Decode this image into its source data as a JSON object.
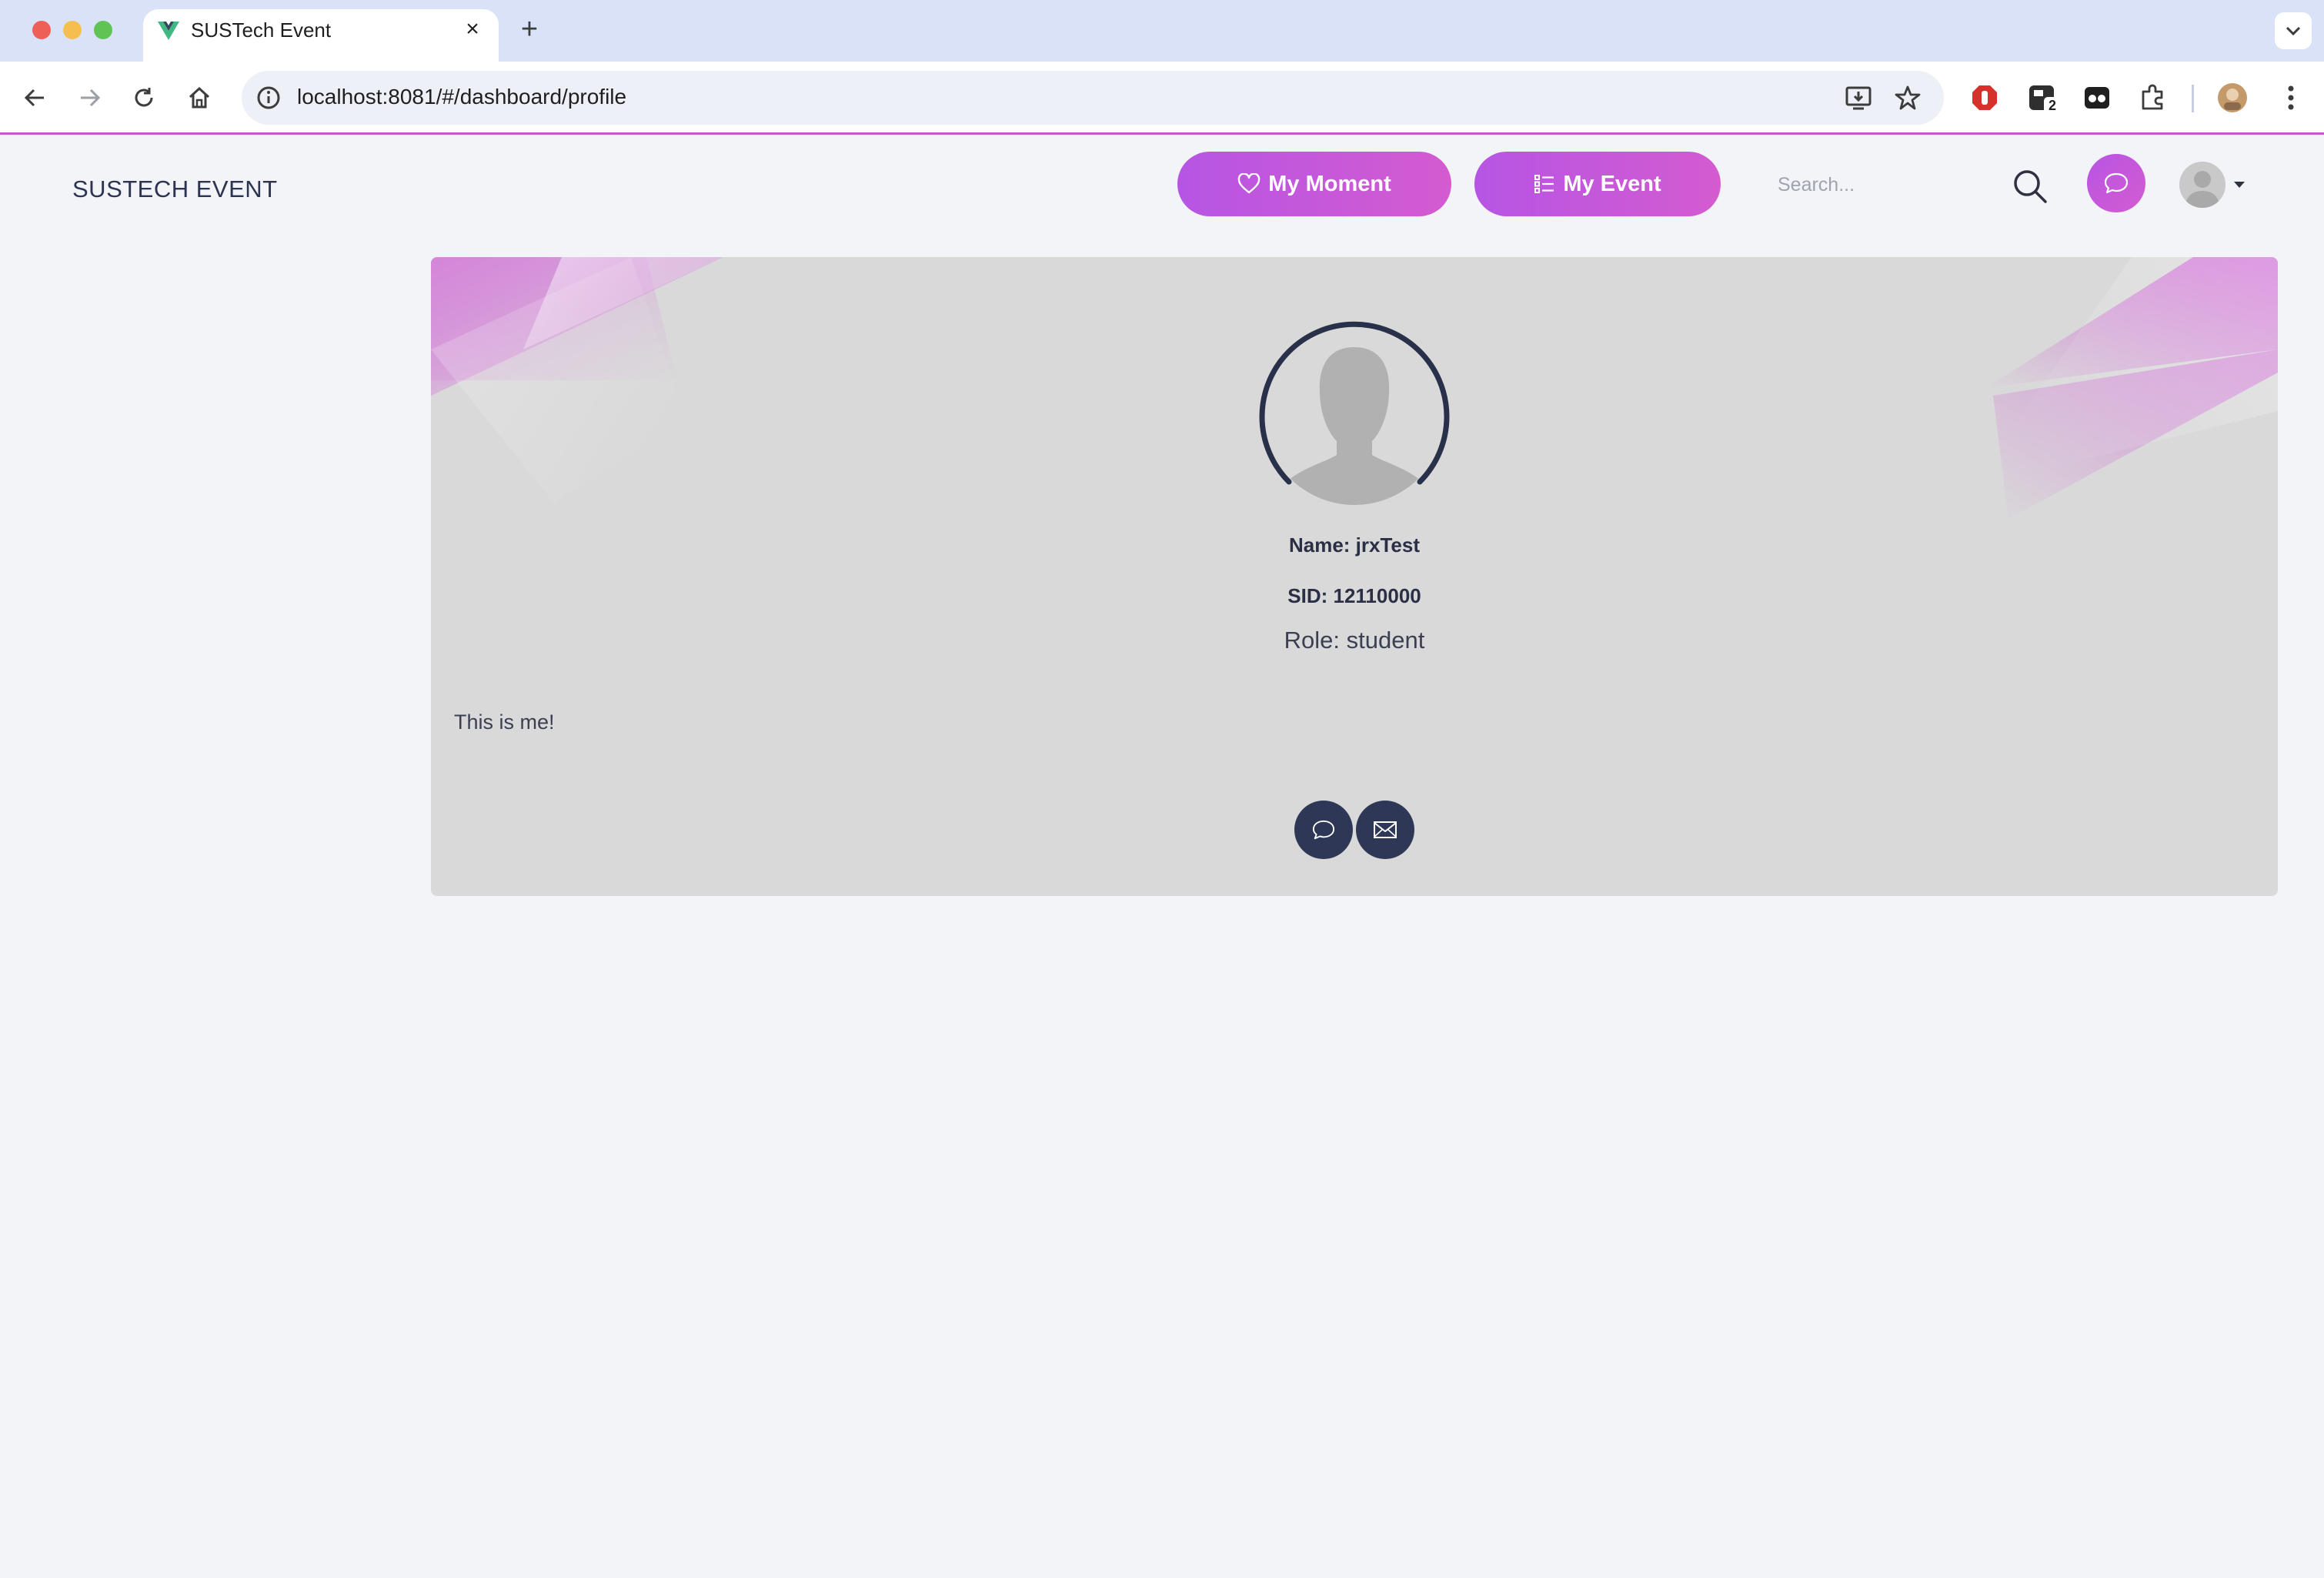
{
  "browser": {
    "tab_title": "SUSTech Event",
    "tab_close": "×",
    "new_tab": "+",
    "url": "localhost:8081/#/dashboard/profile",
    "extension_badge": "2"
  },
  "header": {
    "brand": "SUSTECH EVENT",
    "nav": [
      {
        "label": "My Moment",
        "icon": "heart-icon"
      },
      {
        "label": "My Event",
        "icon": "list-icon"
      }
    ],
    "search": {
      "placeholder": "Search...",
      "value": ""
    }
  },
  "profile": {
    "name_line": "Name: jrxTest",
    "sid_line": "SID: 12110000",
    "role_line": "Role: student",
    "bio": "This is me!",
    "actions": [
      {
        "icon": "chat-icon"
      },
      {
        "icon": "mail-icon"
      }
    ]
  },
  "colors": {
    "accent_gradient_start": "#b655e4",
    "accent_gradient_end": "#d45bd0",
    "navy": "#2e3856",
    "card_bg": "#d9d9d9",
    "page_bg": "#f3f4f8"
  }
}
